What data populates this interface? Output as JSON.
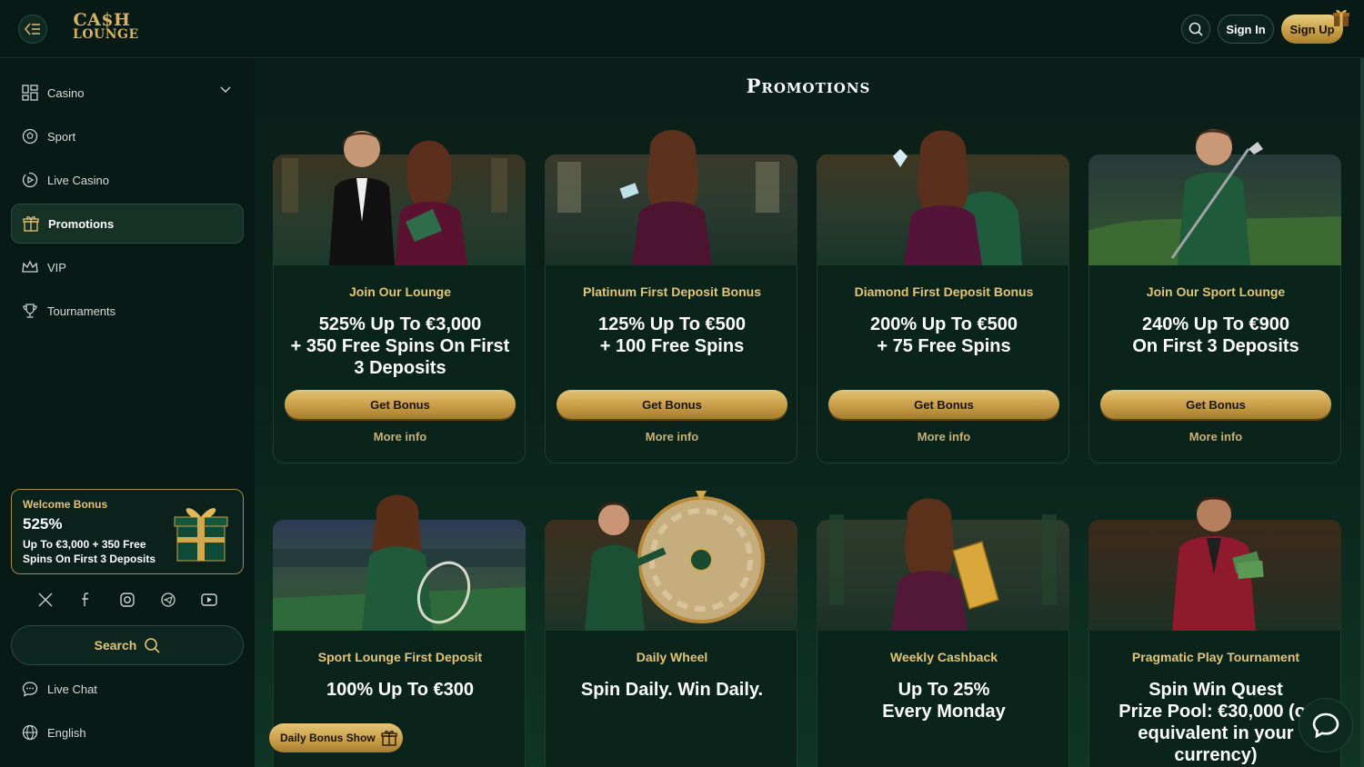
{
  "brand": {
    "line1": "CA$H",
    "line2": "LOUNGE"
  },
  "header": {
    "sign_in": "Sign In",
    "sign_up": "Sign Up"
  },
  "sidebar": {
    "items": [
      {
        "label": "Casino",
        "icon": "casino-grid-icon"
      },
      {
        "label": "Sport",
        "icon": "sport-ball-icon"
      },
      {
        "label": "Live Casino",
        "icon": "live-play-icon"
      },
      {
        "label": "Promotions",
        "icon": "gift-icon",
        "active": true
      },
      {
        "label": "VIP",
        "icon": "crown-icon"
      },
      {
        "label": "Tournaments",
        "icon": "trophy-icon"
      }
    ],
    "welcome": {
      "title": "Welcome Bonus",
      "amount": "525%",
      "description": "Up To €3,000 + 350 Free Spins On First 3 Deposits"
    },
    "search_label": "Search",
    "live_chat": "Live Chat",
    "language": "English"
  },
  "page": {
    "title": "Promotions"
  },
  "promotions": [
    {
      "category": "Join Our Lounge",
      "headline": "525% Up To €3,000\n+ 350 Free Spins On First\n3 Deposits",
      "button": "Get Bonus",
      "more": "More info"
    },
    {
      "category": "Platinum First Deposit Bonus",
      "headline": "125% Up To €500\n+ 100 Free Spins",
      "button": "Get Bonus",
      "more": "More info"
    },
    {
      "category": "Diamond First Deposit Bonus",
      "headline": "200% Up To €500\n+ 75 Free Spins",
      "button": "Get Bonus",
      "more": "More info"
    },
    {
      "category": "Join Our Sport Lounge",
      "headline": "240% Up To €900\nOn First 3 Deposits",
      "button": "Get Bonus",
      "more": "More info"
    },
    {
      "category": "Sport Lounge First Deposit",
      "headline": "100% Up To €300"
    },
    {
      "category": "Daily Wheel",
      "headline": "Spin Daily. Win Daily."
    },
    {
      "category": "Weekly Cashback",
      "headline": "Up To 25%\nEvery Monday"
    },
    {
      "category": "Pragmatic Play Tournament",
      "headline": "Spin Win Quest\nPrize Pool: €30,000 (or\nequivalent in your\ncurrency)"
    }
  ],
  "floating": {
    "daily_bonus": "Daily Bonus Show"
  },
  "colors": {
    "accent_gold": "#e3c474",
    "background": "#071a15",
    "card": "#0a241c"
  }
}
